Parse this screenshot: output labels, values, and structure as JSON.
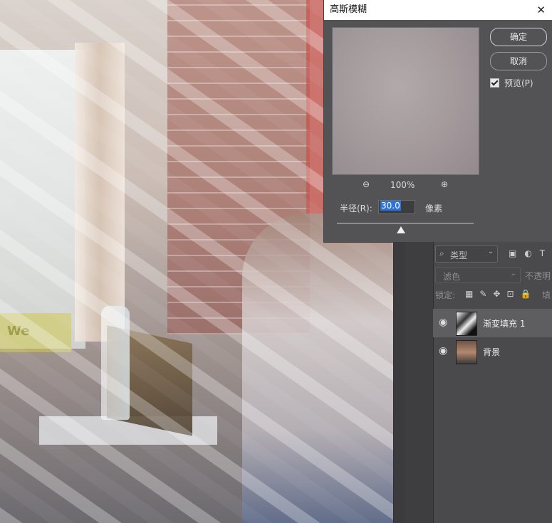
{
  "dialog": {
    "title": "高斯模糊",
    "ok_label": "确定",
    "cancel_label": "取消",
    "preview_label": "预览(P)",
    "preview_checked": true,
    "zoom_percent": "100%",
    "radius_label": "半径(R):",
    "radius_value": "30.0",
    "radius_unit": "像素"
  },
  "canvas": {
    "sign_text": "We"
  },
  "layers_panel": {
    "filter_kind": "类型",
    "blend_mode": "滤色",
    "opacity_label": "不透明",
    "lock_label": "锁定:",
    "fill_label": "填",
    "layers": [
      {
        "name": "渐变填充 1",
        "active": true
      },
      {
        "name": "背景",
        "active": false
      }
    ]
  }
}
